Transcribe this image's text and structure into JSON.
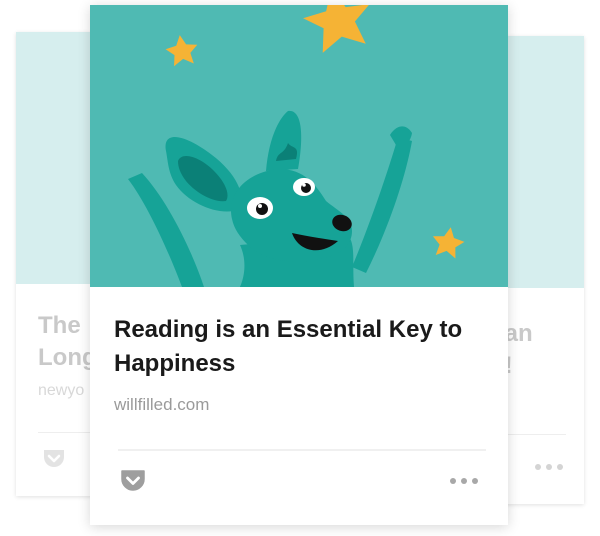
{
  "colors": {
    "image_bg": "#4fbab3",
    "faded_image_bg": "#d6eeee",
    "star": "#f5b335",
    "kangaroo": "#16a397",
    "kangaroo_dark": "#0b8077",
    "title_text": "#1a1a1a",
    "source_text": "#9a9a9a",
    "faded_text": "#c9c9c9",
    "pocket_icon": "#9e9e9e"
  },
  "left_card": {
    "title_line1": "The",
    "title_line2": "Long",
    "source": "newyo",
    "pocket_icon": "pocket-icon"
  },
  "right_card": {
    "title_line1": "han",
    "title_line2": "g!",
    "more_icon": "more-dots-icon"
  },
  "main_card": {
    "image_icon": "kangaroo-illustration",
    "title": "Reading is an Essential Key to Happiness",
    "source": "willfilled.com",
    "pocket_icon": "pocket-icon",
    "more_icon": "more-dots-icon"
  }
}
